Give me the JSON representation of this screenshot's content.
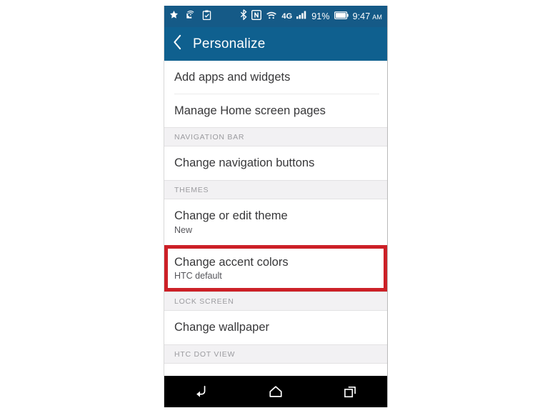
{
  "statusbar": {
    "left_icons": [
      "star-icon",
      "wifi-calling-icon",
      "clipboard-icon"
    ],
    "right_icons": [
      "bluetooth-icon",
      "nfc-icon",
      "wifi-icon"
    ],
    "network_type": "4G",
    "battery_percent": "91%",
    "time": "9:47",
    "meridiem": "AM"
  },
  "appbar": {
    "back_icon": "back-chevron-icon",
    "title": "Personalize"
  },
  "list": [
    {
      "kind": "item",
      "title": "Add apps and widgets",
      "sub": "",
      "divider": true,
      "highlight": false
    },
    {
      "kind": "item",
      "title": "Manage Home screen pages",
      "sub": "",
      "divider": false,
      "highlight": false
    },
    {
      "kind": "header",
      "title": "NAVIGATION BAR"
    },
    {
      "kind": "item",
      "title": "Change navigation buttons",
      "sub": "",
      "divider": false,
      "highlight": false
    },
    {
      "kind": "header",
      "title": "THEMES"
    },
    {
      "kind": "item",
      "title": "Change or edit theme",
      "sub": "New",
      "divider": false,
      "highlight": false
    },
    {
      "kind": "item",
      "title": "Change accent colors",
      "sub": "HTC default",
      "divider": false,
      "highlight": true
    },
    {
      "kind": "header",
      "title": "LOCK SCREEN"
    },
    {
      "kind": "item",
      "title": "Change wallpaper",
      "sub": "",
      "divider": false,
      "highlight": false
    },
    {
      "kind": "header",
      "title": "HTC DOT VIEW"
    }
  ],
  "navbar": {
    "buttons": [
      "back-nav-icon",
      "home-nav-icon",
      "recent-apps-nav-icon"
    ]
  },
  "colors": {
    "statusbar_blue": "#155a87",
    "appbar_blue": "#0f608f",
    "annotation_red": "#cc2027",
    "section_header_bg": "#f2f1f3",
    "navbar_black": "#000000"
  }
}
